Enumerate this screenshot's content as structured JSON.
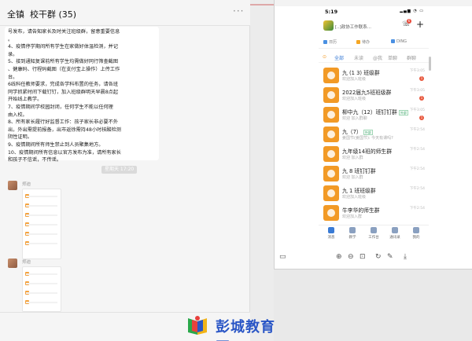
{
  "chat": {
    "header": {
      "user": "全镇",
      "group": "校干群 (35)",
      "more": "···"
    },
    "lines": [
      "号发布，请告知家长及时关注班级群，留意重要信息",
      "。",
      "4、疫情停学期间所有学生在家做好体温检测，并记",
      "录。",
      "5、接到通知复课前所有学生均需做好同行筛查截图",
      "、健康码、行程码截图（在支付宝上操作）上传工作",
      "台。",
      "6线科任教师要求，完成各学科布置的任务，请各班",
      "同学抓紧时间下载钉钉，加入班级群明天早晨8点起",
      "开始线上教学。",
      "7、疫情期间学校园封闭，任何学生不能以任何理",
      "由入校。",
      "8、所有家长履行好监督工作：孩子家长非必要不外",
      "出，外出需提前报备，出市返徐需持48小时核酸检测",
      "阴性证明。",
      "9、疫情期间所有师生禁止到人员聚集地方。",
      "10、疫情期间所有信息以官方发布为准，请所有家长",
      "和孩子不信谣，不传谣。"
    ],
    "timestamp": "星期天 17:20",
    "sender_name": "郑迪",
    "more_icon": "more-icon"
  },
  "phone": {
    "status_time": "5:19",
    "status_icons": "▂▄▆ ◔ ▭",
    "org_name": "[..]政协工作联系...",
    "contacts_badge": "6",
    "quick": [
      {
        "label": "日历",
        "color": "#4a90e2"
      },
      {
        "label": "待办",
        "color": "#f5a623"
      },
      {
        "label": "DING",
        "color": "#4a90e2"
      }
    ],
    "filters": [
      "⊙",
      "全部",
      "未读",
      "@我",
      "单聊",
      "群聊"
    ],
    "conversations": [
      {
        "title": "九 (1 3) 班级群",
        "subtitle": "欢迎加入班级",
        "time": "下午3:05",
        "badge": "1",
        "tag": ""
      },
      {
        "title": "2022届九5班班级群",
        "subtitle": "欢迎加入班级",
        "time": "下午3:05",
        "badge": "1",
        "tag": ""
      },
      {
        "title": "柳中九（12）班钉钉群",
        "subtitle": "欢迎 加入群聊",
        "time": "下午3:05",
        "badge": "1",
        "tag": "外部"
      },
      {
        "title": "九（7）",
        "subtitle": "姜国节(姜国节): 今天有课吗?",
        "time": "下午2:54",
        "badge": "",
        "tag": "外部"
      },
      {
        "title": "九年级14班的师生群",
        "subtitle": "欢迎 加入群",
        "time": "下午2:54",
        "badge": "",
        "tag": ""
      },
      {
        "title": "九 8 班钉钉群",
        "subtitle": "欢迎 加入群",
        "time": "下午2:54",
        "badge": "",
        "tag": ""
      },
      {
        "title": "九 1 班班级群",
        "subtitle": "欢迎加入班级",
        "time": "下午2:54",
        "badge": "",
        "tag": ""
      },
      {
        "title": "牛李华的师生群",
        "subtitle": "欢迎加入群",
        "time": "下午2:54",
        "badge": "",
        "tag": ""
      }
    ],
    "tabs": [
      {
        "label": "消息",
        "color": "#3a7bd5"
      },
      {
        "label": "教学",
        "color": "#8aa0c0"
      },
      {
        "label": "工作台",
        "color": "#8aa0c0"
      },
      {
        "label": "通讯录",
        "color": "#8aa0c0"
      },
      {
        "label": "我的",
        "color": "#8aa0c0"
      }
    ]
  },
  "toolbar": {
    "zoom_in": "⊕",
    "zoom_out": "⊖",
    "fit": "⊡",
    "rotate": "↻",
    "edit": "✎",
    "download": "⤓",
    "screen": "▭"
  },
  "watermark": {
    "text": "彭城教育网"
  }
}
